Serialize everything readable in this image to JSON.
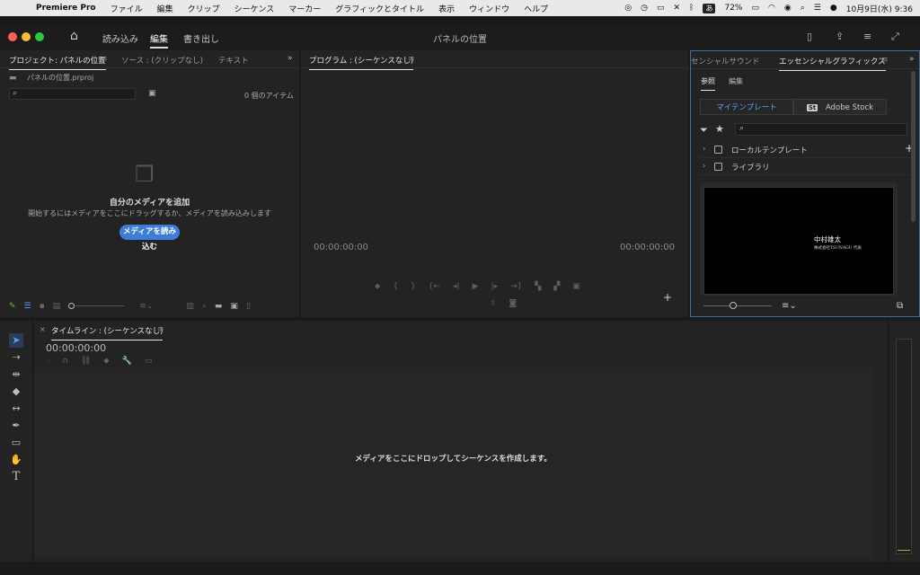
{
  "menubar": {
    "app": "Premiere Pro",
    "items": [
      "ファイル",
      "編集",
      "クリップ",
      "シーケンス",
      "マーカー",
      "グラフィックとタイトル",
      "表示",
      "ウィンドウ",
      "ヘルプ"
    ],
    "input_source": "あ",
    "battery": "72%",
    "datetime": "10月9日(水)  9:36"
  },
  "titlebar": {
    "title": "パネルの位置",
    "workspaces": [
      "読み込み",
      "編集",
      "書き出し"
    ],
    "active_workspace": "編集"
  },
  "project": {
    "tabs": [
      "プロジェクト: パネルの位置",
      "ソース : (クリップなし)",
      "テキスト"
    ],
    "file": "パネルの位置.prproj",
    "item_count": "0 個のアイテム",
    "empty_title": "自分のメディアを追加",
    "empty_desc": "開始するにはメディアをここにドラッグするか、メディアを読み込みします",
    "import_button": "メディアを読み込む"
  },
  "program": {
    "tab": "プログラム : (シーケンスなし)",
    "tc_left": "00:00:00:00",
    "tc_right": "00:00:00:00"
  },
  "essential": {
    "tabs": [
      "センシャルサウンド",
      "エッセンシャルグラフィックス"
    ],
    "subtabs": [
      "参照",
      "編集"
    ],
    "seg_my": "マイテンプレート",
    "seg_stock": "Adobe Stock",
    "stock_badge": "St",
    "tree": [
      "ローカルテンプレート",
      "ライブラリ"
    ],
    "thumb_line1": "中村雄太",
    "thumb_line2": "株式会社TSUNAGU 代表"
  },
  "timeline": {
    "tab": "タイムライン : (シーケンスなし)",
    "timecode": "00:00:00:00",
    "drop_msg": "メディアをここにドロップしてシーケンスを作成します。"
  },
  "colors": {
    "accent": "#3d7dd8",
    "panel_bg": "#232323",
    "app_bg": "#1a1a1a",
    "focus_border": "#3b6fa6"
  }
}
